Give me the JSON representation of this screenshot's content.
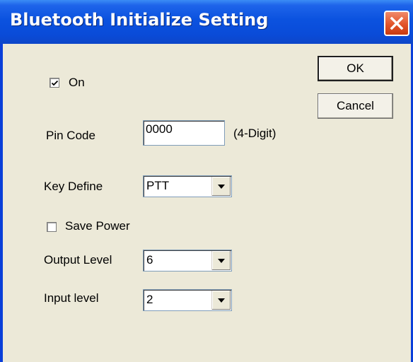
{
  "window": {
    "title": "Bluetooth Initialize Setting"
  },
  "buttons": {
    "ok": "OK",
    "cancel": "Cancel"
  },
  "on": {
    "label": "On",
    "checked": true
  },
  "pin_code": {
    "label": "Pin Code",
    "value": "0000",
    "hint": "(4-Digit)"
  },
  "key_define": {
    "label": "Key Define",
    "value": "PTT"
  },
  "save_power": {
    "label": "Save Power",
    "checked": false
  },
  "output_level": {
    "label": "Output Level",
    "value": "6"
  },
  "input_level": {
    "label": "Input level",
    "value": "2"
  },
  "icons": {
    "close": "close-icon",
    "check": "check-icon",
    "dropdown": "chevron-down-icon"
  },
  "colors": {
    "titlebar": "#0a4bd8",
    "close": "#e2542a",
    "face": "#ece9d8"
  }
}
